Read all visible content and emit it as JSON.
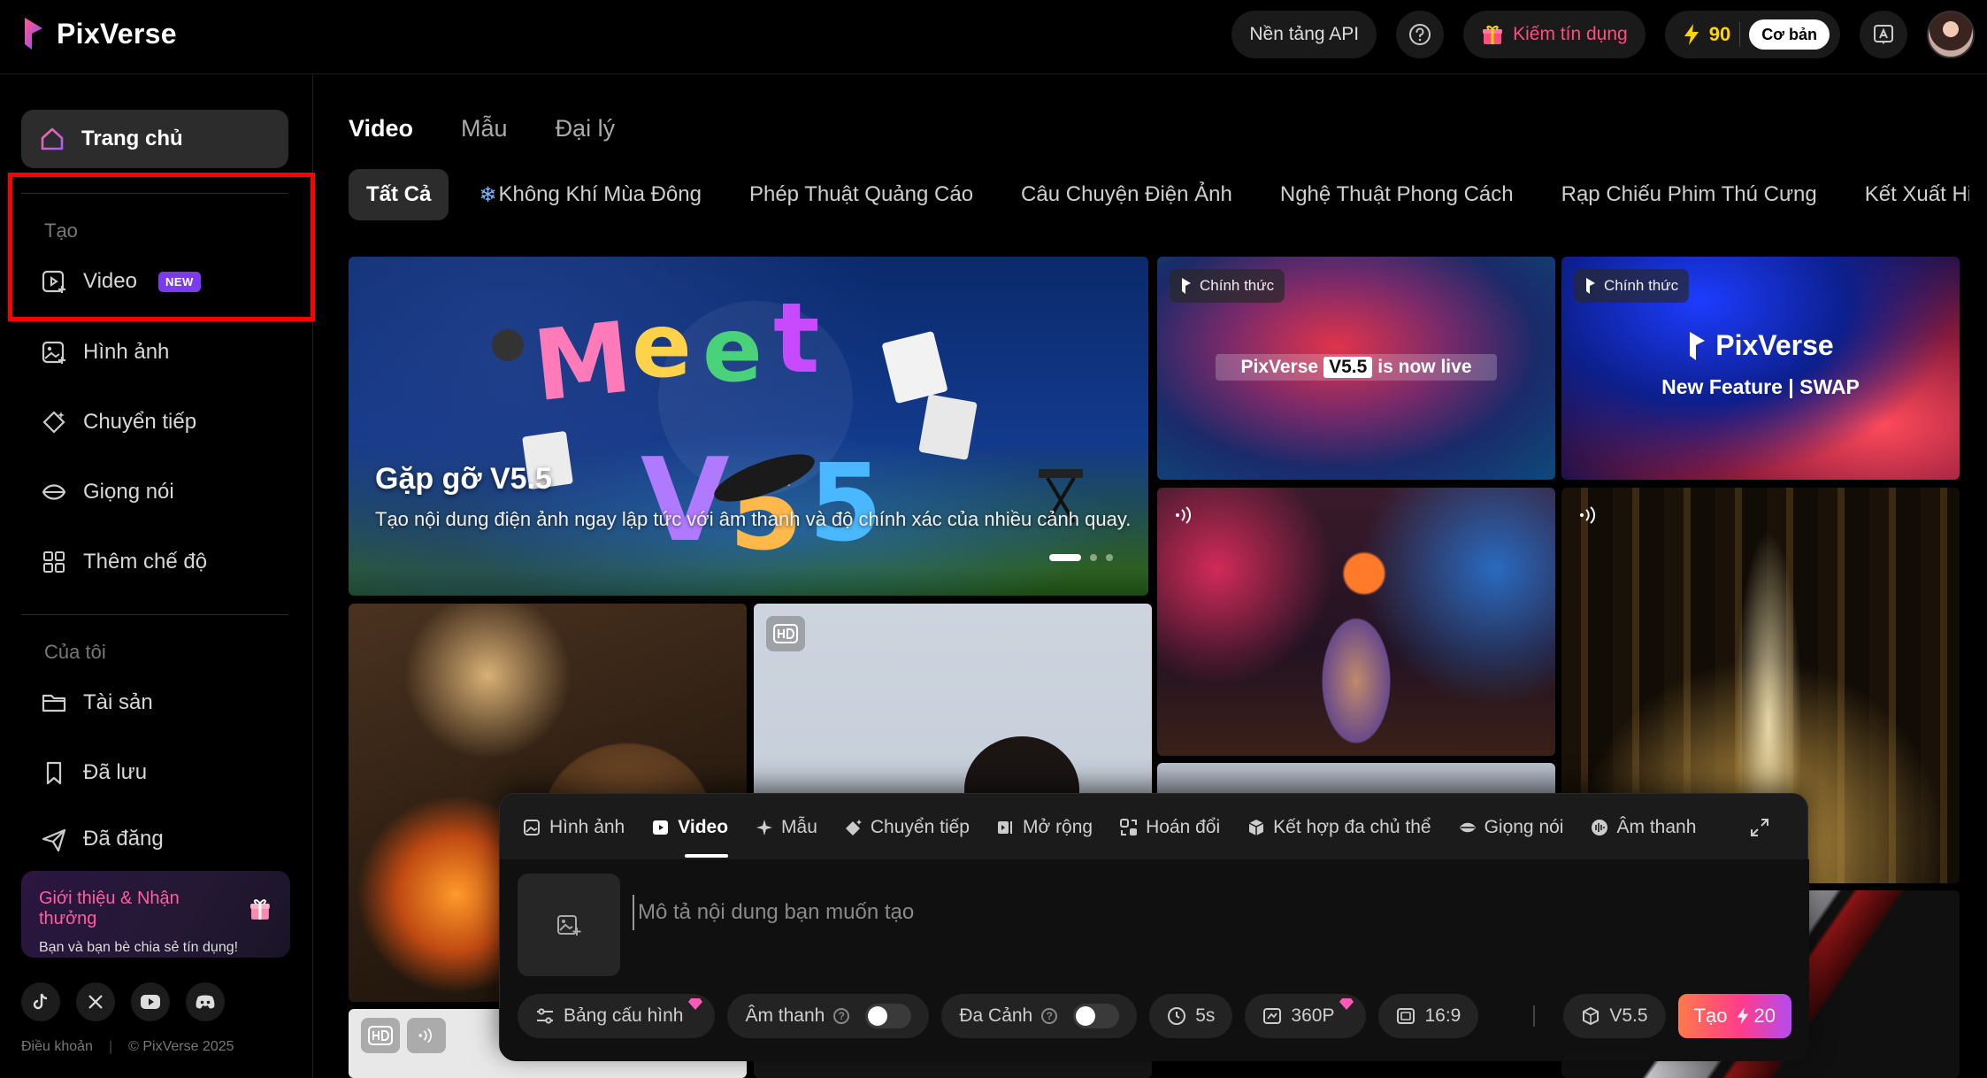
{
  "app": {
    "name": "PixVerse"
  },
  "topbar": {
    "api_label": "Nền tảng API",
    "earn_label": "Kiếm tín dụng",
    "credits": "90",
    "plan_label": "Cơ bản"
  },
  "sidebar": {
    "home_label": "Trang chủ",
    "create_section": "Tạo",
    "create_items": [
      {
        "label": "Video",
        "badge": "NEW"
      },
      {
        "label": "Hình ảnh"
      },
      {
        "label": "Chuyển tiếp"
      },
      {
        "label": "Giọng nói"
      },
      {
        "label": "Thêm chế độ"
      }
    ],
    "mine_section": "Của tôi",
    "mine_items": [
      {
        "label": "Tài sản"
      },
      {
        "label": "Đã lưu"
      },
      {
        "label": "Đã đăng"
      }
    ],
    "referral": {
      "title": "Giới thiệu & Nhận thưởng",
      "subtitle": "Bạn và bạn bè chia sẻ tín dụng!"
    },
    "footer": {
      "terms": "Điều khoản",
      "copyright": "© PixVerse 2025"
    }
  },
  "main": {
    "tabs": [
      "Video",
      "Mẫu",
      "Đại lý"
    ],
    "filters": [
      "Tất Cả",
      "Không Khí Mùa Đông",
      "Phép Thuật Quảng Cáo",
      "Câu Chuyện Điện Ảnh",
      "Nghệ Thuật Phong Cách",
      "Rạp Chiếu Phim Thú Cưng",
      "Kết Xuất Hiệu"
    ],
    "hero": {
      "title": "Gặp gỡ V5.5",
      "description": "Tạo nội dung điện ảnh ngay lập tức với âm thanh và độ chính xác của nhiều cảnh quay."
    },
    "cards": {
      "official_tag": "Chính thức",
      "v55_banner_left": "PixVerse",
      "v55_banner_box": "V5.5",
      "v55_banner_right": "is now live",
      "swap_logo": "PixVerse",
      "swap_subtitle": "New Feature | SWAP"
    }
  },
  "panel": {
    "tabs": [
      "Hình ảnh",
      "Video",
      "Mẫu",
      "Chuyển tiếp",
      "Mở rộng",
      "Hoán đổi",
      "Kết hợp đa chủ thể",
      "Giọng nói",
      "Âm thanh"
    ],
    "prompt_placeholder": "Mô tả nội dung bạn muốn tạo",
    "controls": {
      "config": "Bảng cấu hình",
      "audio": "Âm thanh",
      "multishot": "Đa Cảnh",
      "duration": "5s",
      "resolution": "360P",
      "ratio": "16:9",
      "model": "V5.5",
      "create": "Tạo",
      "cost": "20"
    }
  },
  "colors": {
    "accent_pink": "#ff4d7d",
    "credit_yellow": "#ffd400",
    "badge_purple": "#7b3cf0",
    "highlight": "#ff0000"
  }
}
